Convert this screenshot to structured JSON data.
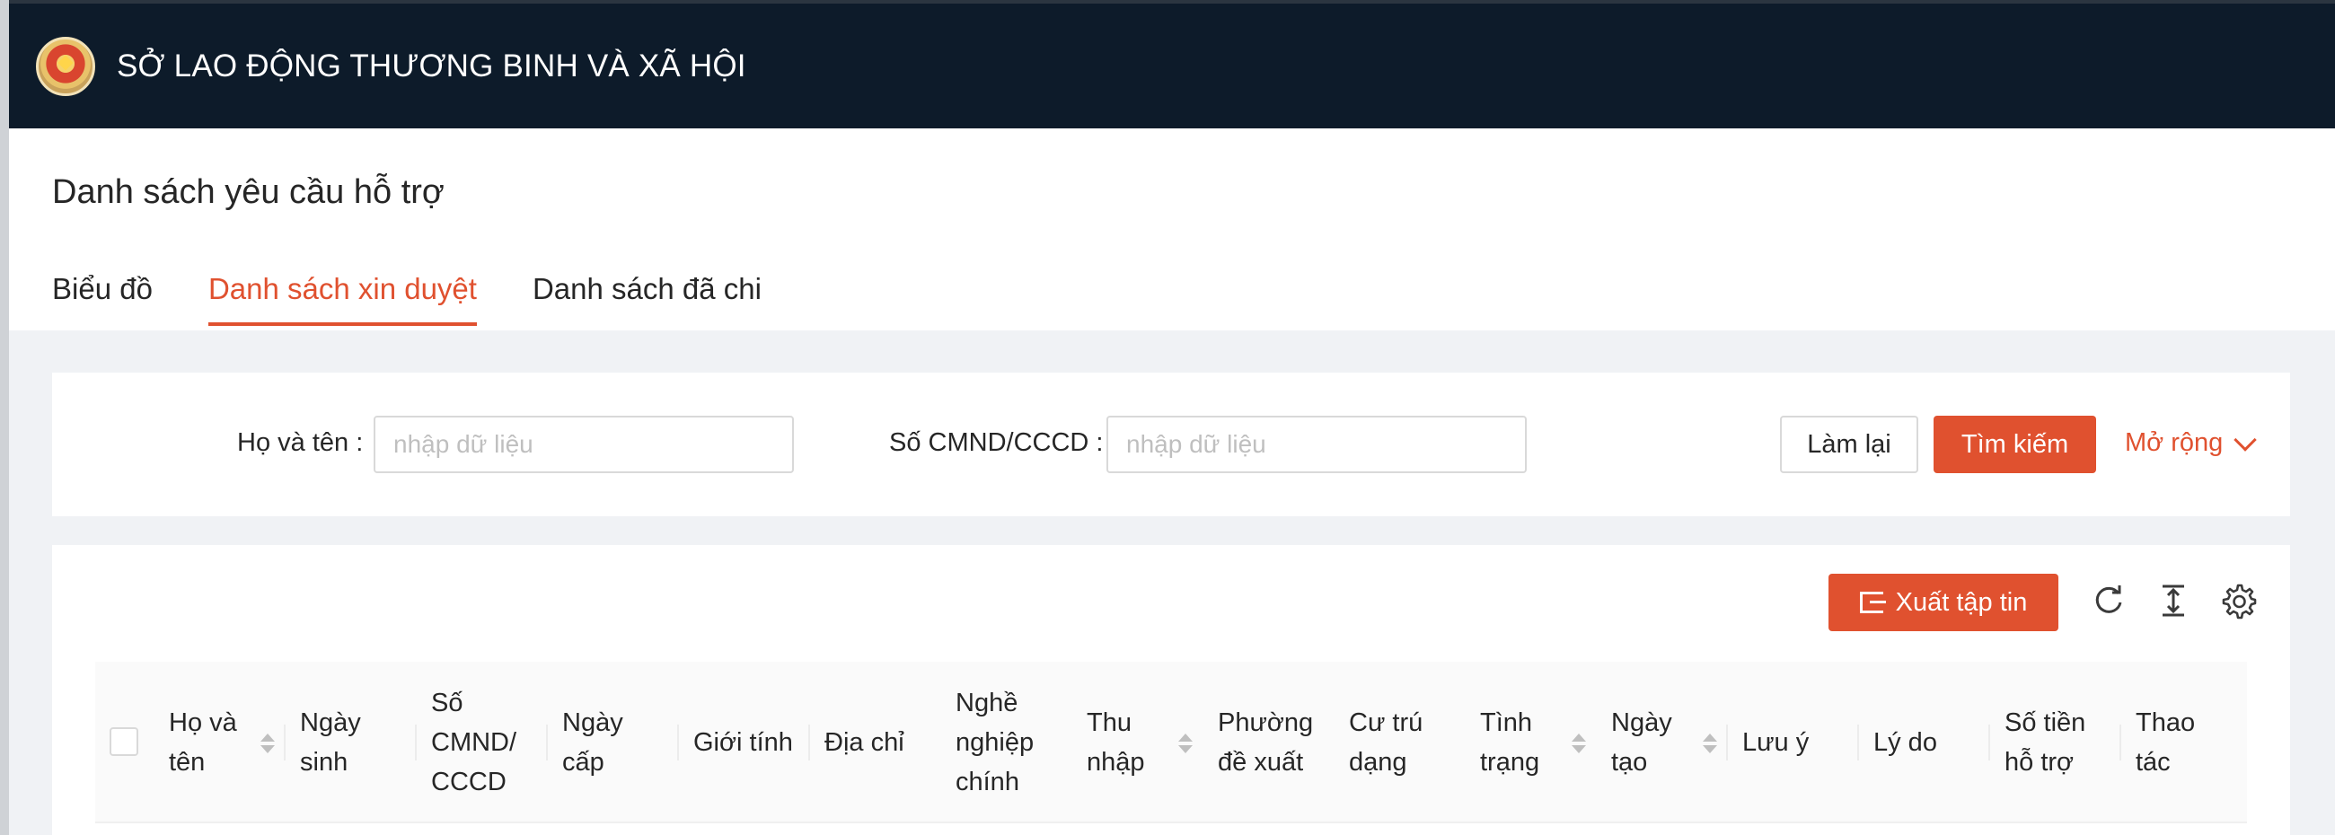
{
  "header": {
    "title": "SỞ LAO ĐỘNG THƯƠNG BINH VÀ XÃ HỘI",
    "logo_icon": "emblem-logo"
  },
  "page": {
    "title": "Danh sách yêu cầu hỗ trợ"
  },
  "tabs": [
    {
      "label": "Biểu đồ",
      "active": false
    },
    {
      "label": "Danh sách xin duyệt",
      "active": true
    },
    {
      "label": "Danh sách đã chi",
      "active": false
    }
  ],
  "search": {
    "name_label": "Họ và tên",
    "name_placeholder": "nhập dữ liệu",
    "name_value": "",
    "id_label": "Số CMND/CCCD",
    "id_placeholder": "nhập dữ liệu",
    "id_value": "",
    "reset_label": "Làm lại",
    "search_label": "Tìm kiếm",
    "expand_label": "Mở rộng"
  },
  "toolbar": {
    "export_label": "Xuất tập tin",
    "icons": [
      "refresh-icon",
      "column-height-icon",
      "settings-icon"
    ]
  },
  "table": {
    "columns": [
      {
        "label": "Họ và tên",
        "sortable": true
      },
      {
        "label": "Ngày sinh",
        "sortable": false
      },
      {
        "label": "Số CMND/ CCCD",
        "sortable": false
      },
      {
        "label": "Ngày cấp",
        "sortable": false
      },
      {
        "label": "Giới tính",
        "sortable": false
      },
      {
        "label": "Địa chỉ",
        "sortable": false
      },
      {
        "label": "Nghề nghiệp chính",
        "sortable": false
      },
      {
        "label": "Thu nhập",
        "sortable": true
      },
      {
        "label": "Phường đề xuất",
        "sortable": false
      },
      {
        "label": "Cư trú dạng",
        "sortable": false
      },
      {
        "label": "Tình trạng",
        "sortable": true
      },
      {
        "label": "Ngày tạo",
        "sortable": true
      },
      {
        "label": "Lưu ý",
        "sortable": false
      },
      {
        "label": "Lý do",
        "sortable": false
      },
      {
        "label": "Số tiền hỗ trợ",
        "sortable": false
      },
      {
        "label": "Thao tác",
        "sortable": false
      }
    ]
  },
  "colors": {
    "accent": "#e0512f",
    "header_bg": "#0d1b2a"
  }
}
